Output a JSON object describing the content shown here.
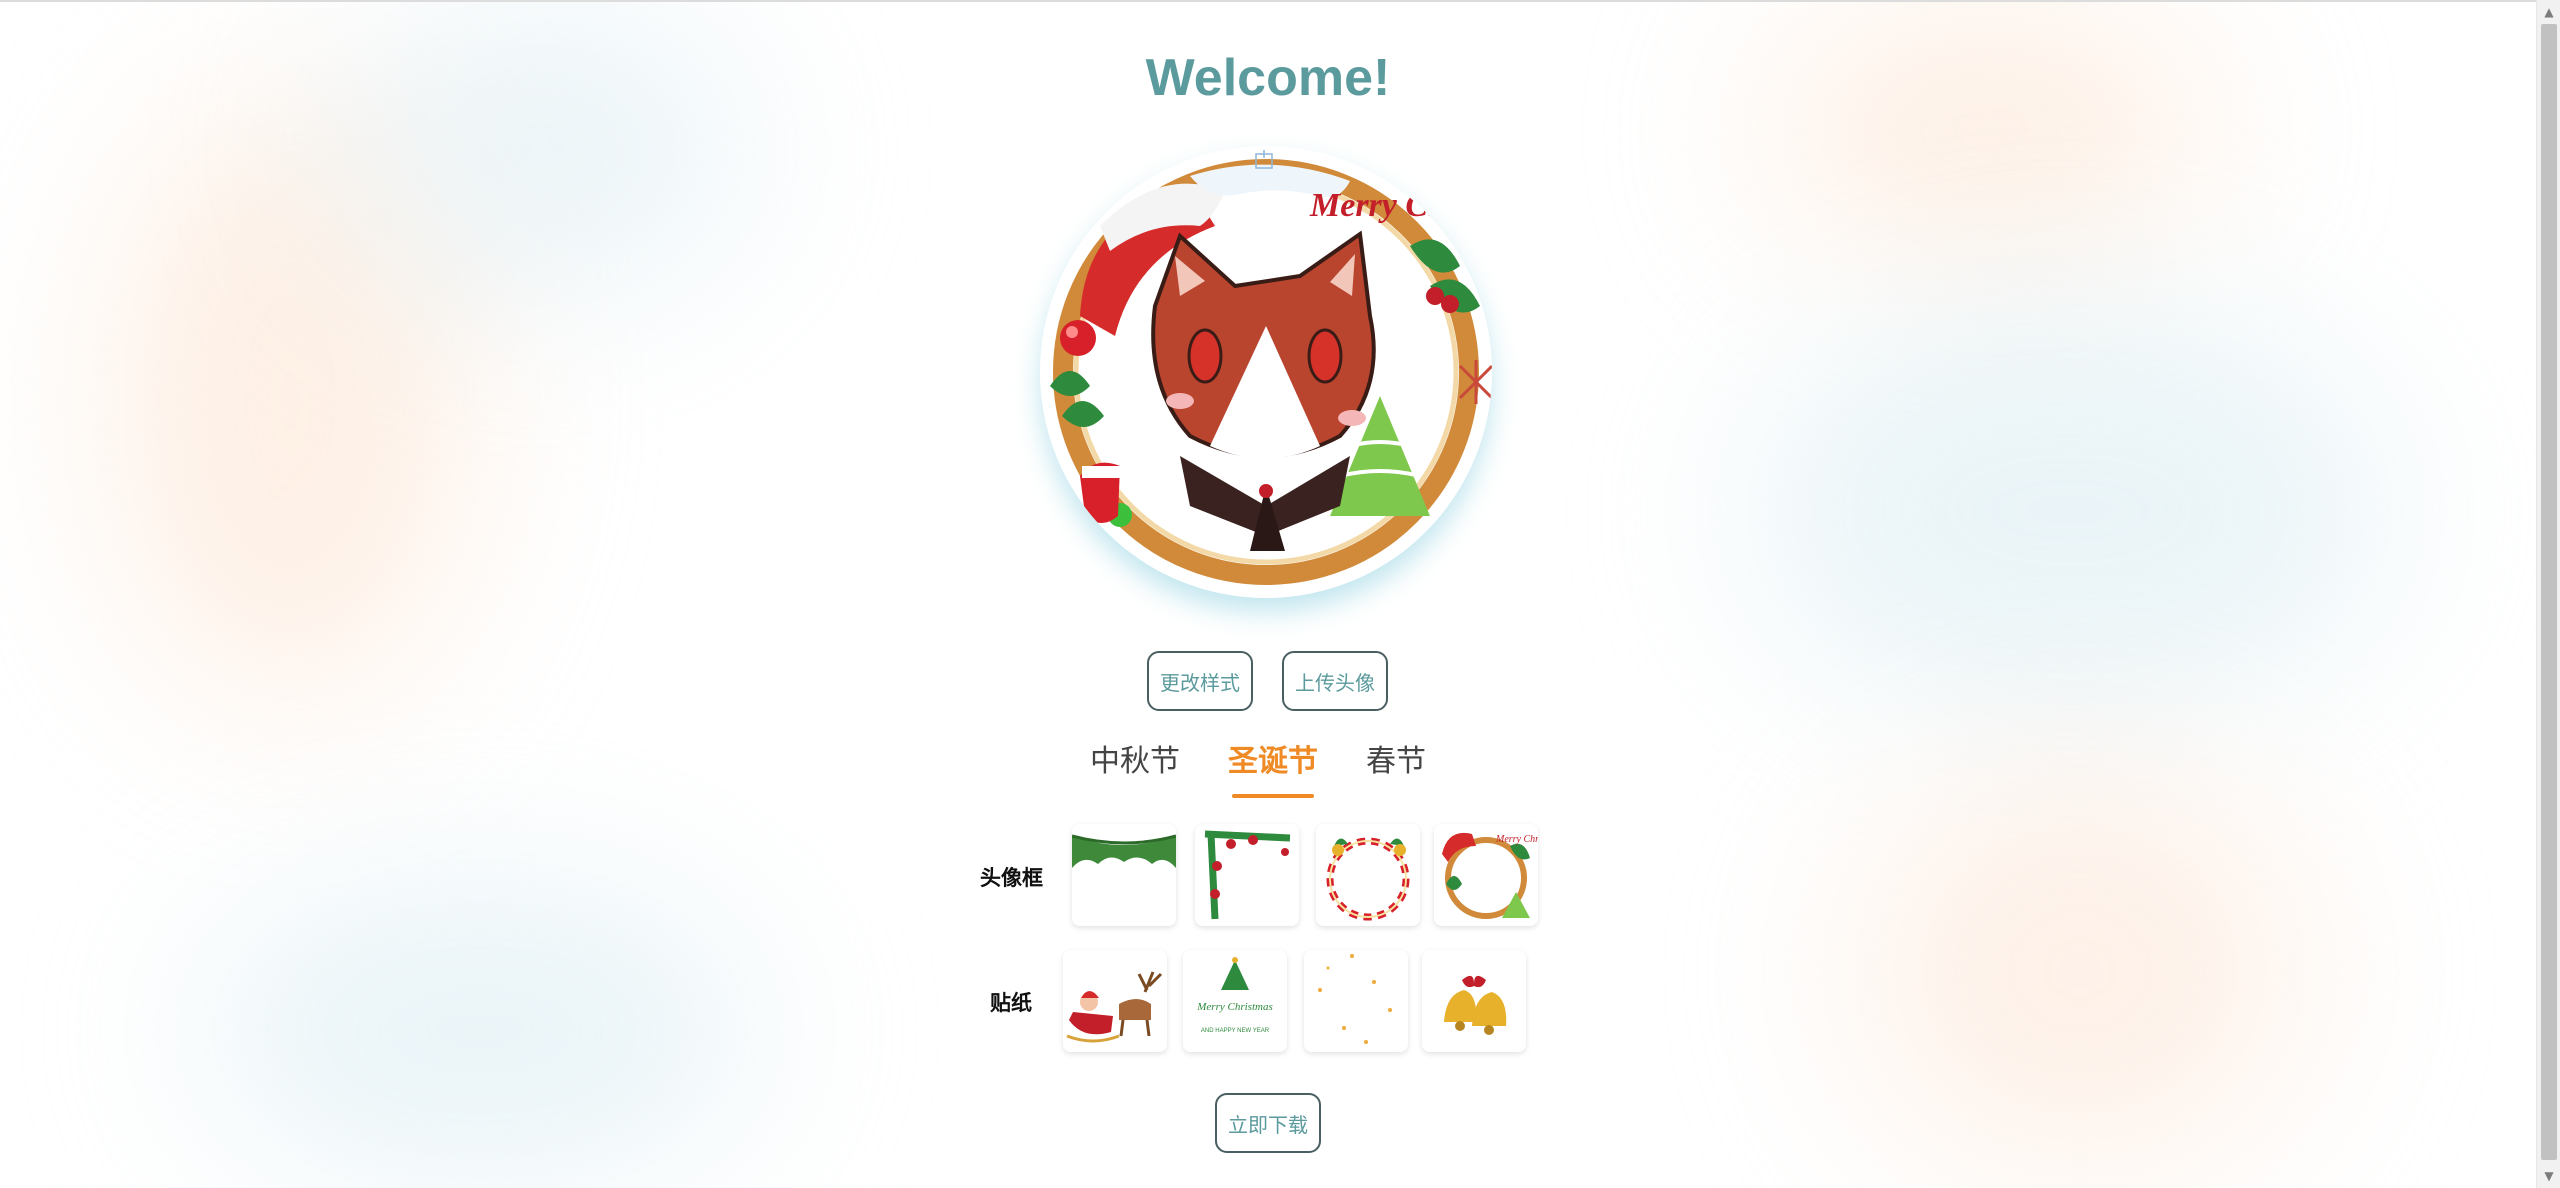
{
  "page": {
    "title": "Welcome!"
  },
  "avatar": {
    "badge_text": "Merry Christmas"
  },
  "actions": {
    "change_style": "更改样式",
    "upload_avatar": "上传头像",
    "download": "立即下载"
  },
  "tabs": [
    {
      "label": "中秋节",
      "active": false
    },
    {
      "label": "圣诞节",
      "active": true
    },
    {
      "label": "春节",
      "active": false
    }
  ],
  "frames": {
    "label": "头像框",
    "items": [
      {
        "icon": "pine-garland-frame-icon"
      },
      {
        "icon": "holly-corner-frame-icon"
      },
      {
        "icon": "candy-cane-ring-frame-icon"
      },
      {
        "icon": "merry-christmas-wreath-frame-icon",
        "text": "Merry Christmas"
      }
    ]
  },
  "stickers": {
    "label": "贴纸",
    "items": [
      {
        "icon": "santa-sleigh-reindeer-icon"
      },
      {
        "icon": "christmas-tree-lettering-icon",
        "text": "Merry Christmas",
        "subtext": "AND HAPPY NEW YEAR"
      },
      {
        "icon": "gold-dots-icon"
      },
      {
        "icon": "jingle-bells-icon"
      }
    ]
  },
  "colors": {
    "title": "#5b9a9d",
    "button_text": "#5b9a9d",
    "button_border": "#4a5f62",
    "tab_active": "#f08a24",
    "tab_inactive": "#444444"
  }
}
